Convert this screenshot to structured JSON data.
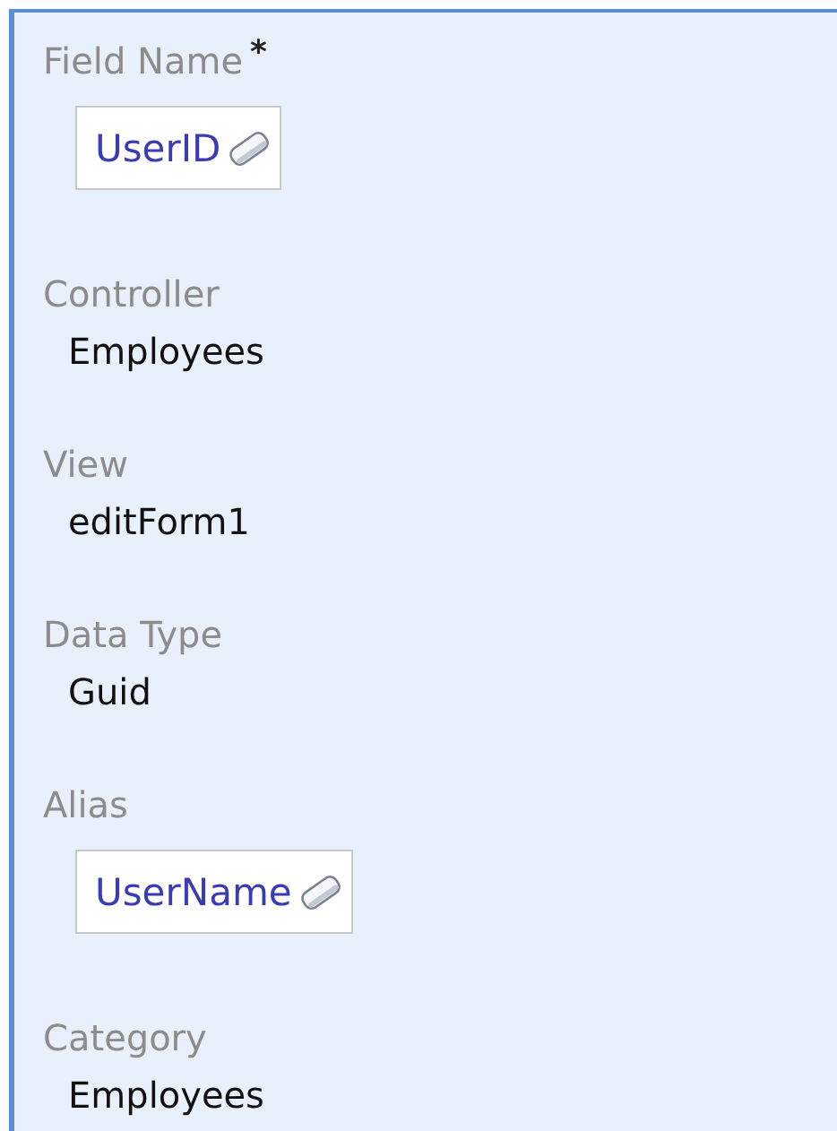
{
  "fields": [
    {
      "label": "Field Name",
      "required_mark": "*",
      "kind": "link",
      "value": "UserID"
    },
    {
      "label": "Controller",
      "kind": "text",
      "value": "Employees"
    },
    {
      "label": "View",
      "kind": "text",
      "value": "editForm1"
    },
    {
      "label": "Data Type",
      "kind": "text",
      "value": "Guid"
    },
    {
      "label": "Alias",
      "kind": "link",
      "value": "UserName"
    },
    {
      "label": "Category",
      "kind": "text",
      "value": "Employees"
    }
  ]
}
